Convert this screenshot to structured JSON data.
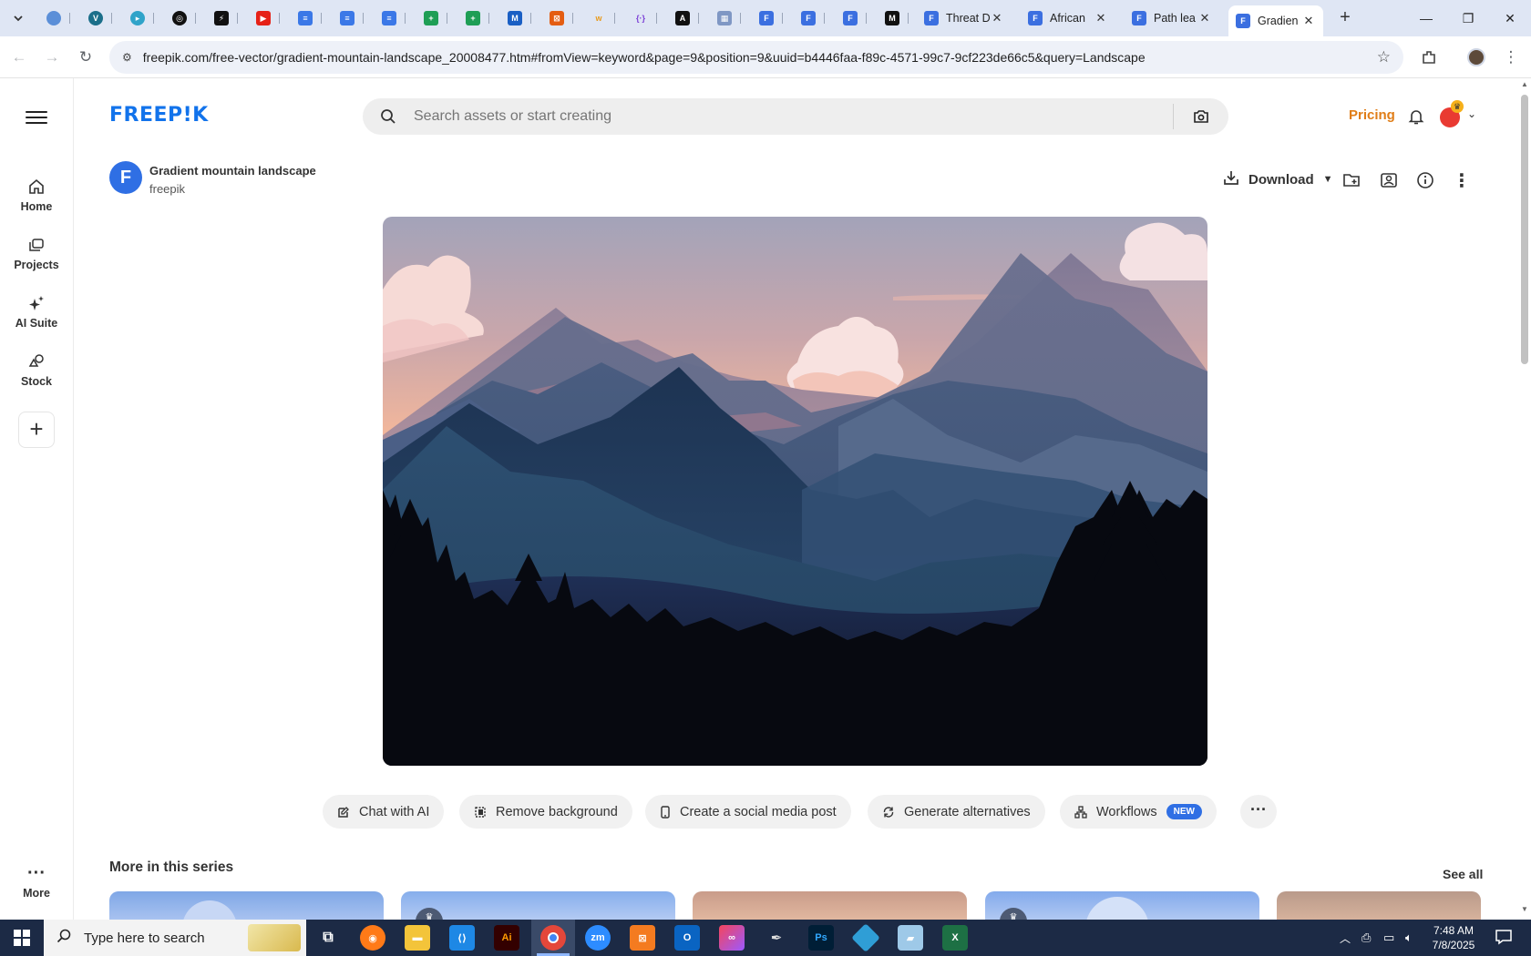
{
  "browser": {
    "tabs": [
      {
        "title": "Threat D",
        "has_close": true
      },
      {
        "title": "African",
        "has_close": true
      },
      {
        "title": "Path lea",
        "has_close": true
      },
      {
        "title": "Gradien",
        "has_close": true,
        "active": true
      }
    ],
    "pinned_icons": [
      "site-icon",
      "site-icon",
      "site-icon",
      "site-icon",
      "site-icon",
      "youtube-icon",
      "docs-icon",
      "docs-icon",
      "docs-icon",
      "sheets-icon",
      "sheets-icon",
      "site-icon",
      "site-icon",
      "site-icon",
      "site-icon",
      "site-icon",
      "site-icon",
      "forms-icon",
      "forms-icon",
      "forms-icon",
      "site-icon"
    ],
    "url": "freepik.com/free-vector/gradient-mountain-landscape_20008477.htm#fromView=keyword&page=9&position=9&uuid=b4446faa-f89c-4571-99c7-9cf223de66c5&query=Landscape"
  },
  "rail": {
    "items": [
      {
        "label": "Home",
        "icon": "home-icon"
      },
      {
        "label": "Projects",
        "icon": "projects-icon"
      },
      {
        "label": "AI Suite",
        "icon": "sparkle-icon"
      },
      {
        "label": "Stock",
        "icon": "stock-icon"
      }
    ],
    "more_label": "More"
  },
  "header": {
    "logo": "FREEP!K",
    "search_placeholder": "Search assets or start creating",
    "pricing": "Pricing"
  },
  "asset": {
    "badge_letter": "F",
    "title": "Gradient mountain landscape",
    "author": "freepik",
    "download_label": "Download"
  },
  "actions": {
    "chat": "Chat with AI",
    "remove_bg": "Remove background",
    "social": "Create a social media post",
    "alternatives": "Generate alternatives",
    "workflows": "Workflows",
    "workflows_badge": "NEW"
  },
  "series": {
    "title": "More in this series",
    "see_all": "See all"
  },
  "taskbar": {
    "search_placeholder": "Type here to search",
    "time": "7:48 AM",
    "date": "7/8/2025"
  },
  "colors": {
    "brand": "#1273eb",
    "pricing": "#e07d17",
    "badge": "#2f6fe4"
  }
}
